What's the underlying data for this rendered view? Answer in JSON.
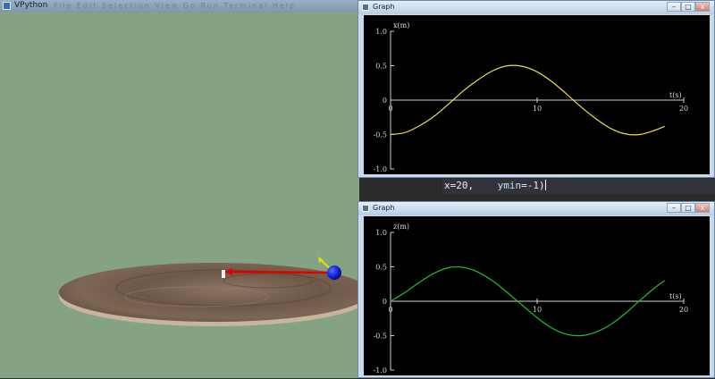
{
  "vpython": {
    "title": "VPython",
    "menu_ghost": "File  Edit  Selection  View  Go  Run  Terminal  Help",
    "colors": {
      "background": "#85a283",
      "disk": "#7a6454",
      "arrow": "#e00000",
      "ball": "#1020ff",
      "velocity": "#e8e000"
    }
  },
  "editor": {
    "prefix": "x=20,",
    "keyword": "ymin",
    "value": "=-1)"
  },
  "graphs": [
    {
      "title": "Graph",
      "buttons": {
        "min": "–",
        "max": "□",
        "close": "x"
      },
      "chart_data": {
        "type": "line",
        "ylabel": "x(m)",
        "xlabel": "t(s)",
        "xlim": [
          0,
          20
        ],
        "ylim": [
          -1,
          1
        ],
        "xticks": [
          "0",
          "10",
          "20"
        ],
        "yticks": [
          "1.0",
          "0.5",
          "0",
          "-0.5",
          "-1.0"
        ],
        "yticks_values": [
          1.0,
          0.5,
          0,
          -0.5,
          -1.0
        ],
        "xticks_values": [
          0,
          10,
          20
        ],
        "color": "#e8e040",
        "series": [
          {
            "x": [
              0,
              1,
              2,
              3,
              4,
              5,
              6,
              7,
              8,
              9,
              10,
              11,
              12,
              13,
              14,
              15,
              16,
              17,
              18,
              18.7
            ],
            "values": [
              -0.5,
              -0.47,
              -0.37,
              -0.23,
              -0.05,
              0.14,
              0.3,
              0.43,
              0.5,
              0.49,
              0.41,
              0.27,
              0.09,
              -0.1,
              -0.27,
              -0.41,
              -0.49,
              -0.5,
              -0.44,
              -0.38
            ]
          }
        ]
      }
    },
    {
      "title": "Graph",
      "buttons": {
        "min": "–",
        "max": "□",
        "close": "x"
      },
      "chart_data": {
        "type": "line",
        "ylabel": "z(m)",
        "xlabel": "t(s)",
        "xlim": [
          0,
          20
        ],
        "ylim": [
          -1,
          1
        ],
        "xticks": [
          "0",
          "10",
          "20"
        ],
        "yticks": [
          "1.0",
          "0.5",
          "0",
          "-0.5",
          "-1.0"
        ],
        "yticks_values": [
          1.0,
          0.5,
          0,
          -0.5,
          -1.0
        ],
        "xticks_values": [
          0,
          10,
          20
        ],
        "color": "#20c020",
        "series": [
          {
            "x": [
              0,
              1,
              2,
              3,
              4,
              5,
              6,
              7,
              8,
              9,
              10,
              11,
              12,
              13,
              14,
              15,
              16,
              17,
              18,
              18.7
            ],
            "values": [
              0,
              0.13,
              0.28,
              0.41,
              0.49,
              0.49,
              0.42,
              0.29,
              0.12,
              -0.06,
              -0.24,
              -0.39,
              -0.48,
              -0.5,
              -0.45,
              -0.34,
              -0.18,
              0.01,
              0.19,
              0.3
            ]
          }
        ]
      }
    }
  ]
}
